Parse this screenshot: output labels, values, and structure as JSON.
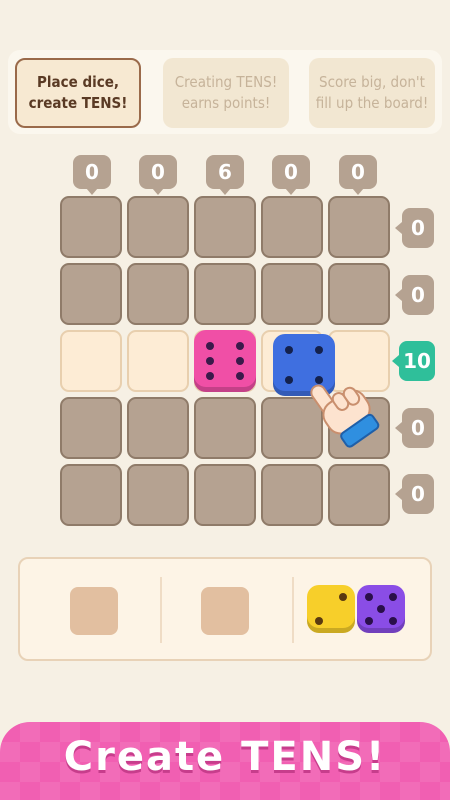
{
  "tips": [
    {
      "text": "Place dice,\ncreate TENS!",
      "active": true
    },
    {
      "text": "Creating TENS!\nearns points!",
      "active": false
    },
    {
      "text": "Score big, don't\nfill up the board!",
      "active": false
    }
  ],
  "column_sums": [
    "0",
    "0",
    "6",
    "0",
    "0"
  ],
  "row_sums": [
    "0",
    "0",
    "10",
    "0",
    "0"
  ],
  "highlight_row": 2,
  "board_dice": [
    {
      "row": 2,
      "col": 2,
      "value": 6,
      "color": "#f04fa6",
      "pip_color": "#3a1a4a"
    },
    {
      "row": 2,
      "col": 3,
      "value": 4,
      "color": "#3f6fe0",
      "pip_color": "#14214d"
    }
  ],
  "tray": {
    "slot_1": "empty",
    "slot_2": "empty",
    "slot_3": [
      {
        "value": 2,
        "color": "#f7cf2a",
        "pip_color": "#5a3a10"
      },
      {
        "value": 5,
        "color": "#8a4de6",
        "pip_color": "#2a0f4a"
      }
    ]
  },
  "hand_icon": "pointer-hand-icon",
  "banner": {
    "text": "Create TENS!",
    "color": "#f15fb2"
  }
}
